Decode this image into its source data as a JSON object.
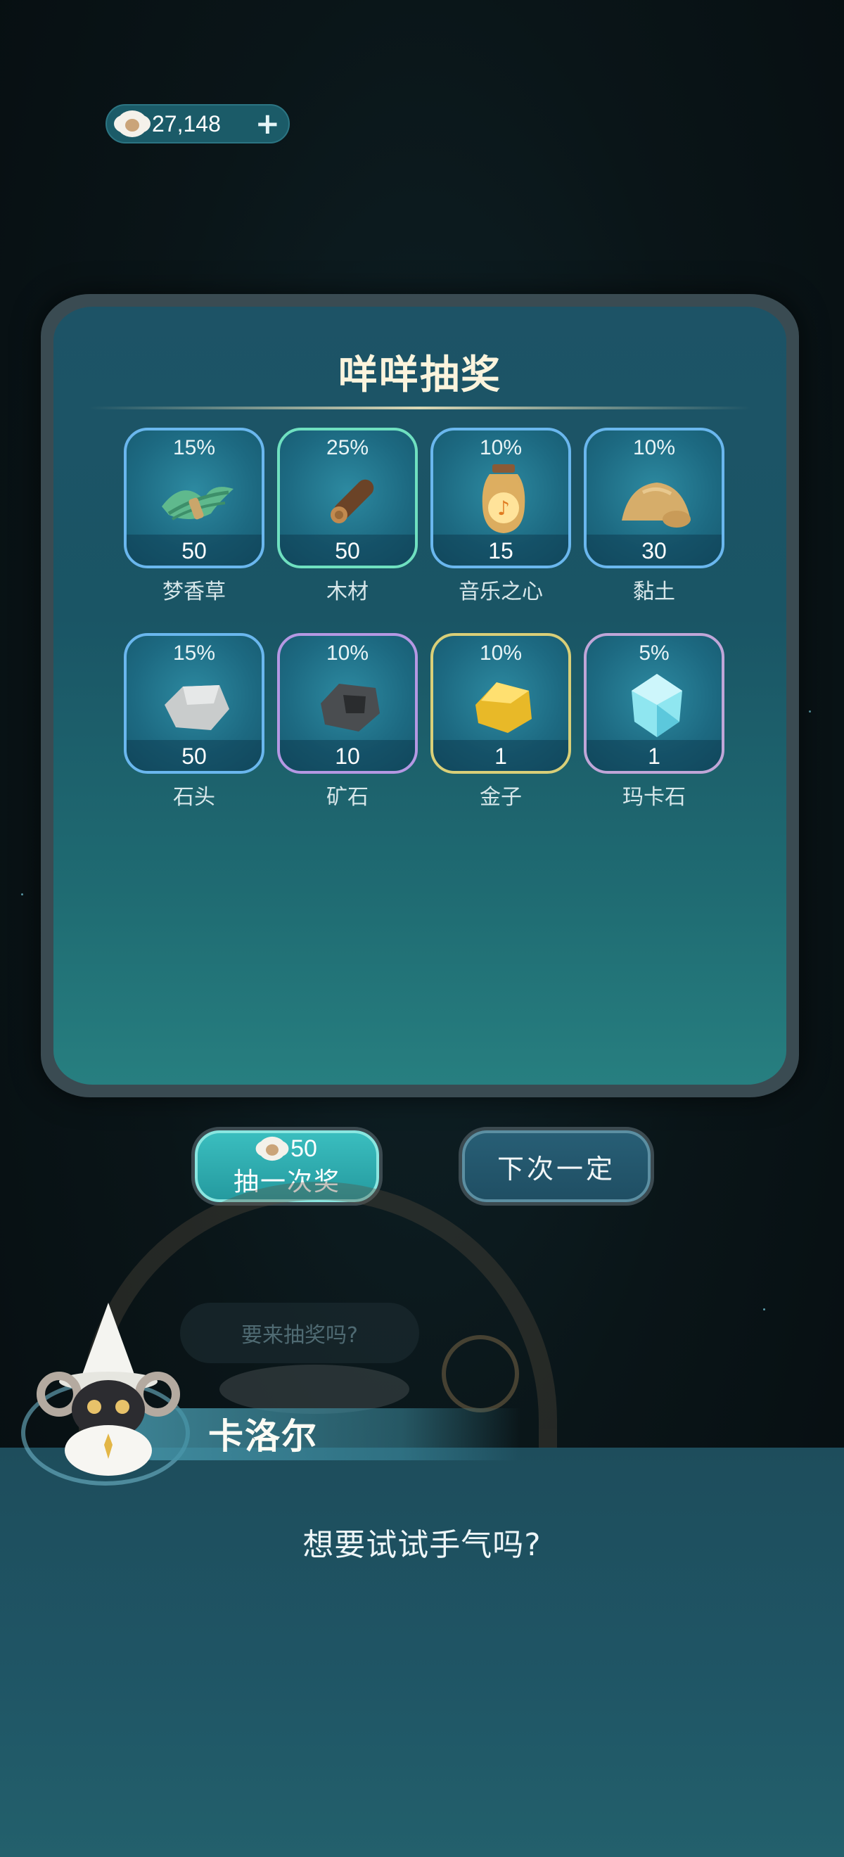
{
  "currency": {
    "amount": "27,148",
    "plus_label": "+",
    "icon": "sheep-coin-icon"
  },
  "panel": {
    "title": "咩咩抽奖"
  },
  "prizes": [
    {
      "name": "梦香草",
      "chance": "15%",
      "quantity": "50",
      "icon": "grass-bundle-icon",
      "rarity": "blue"
    },
    {
      "name": "木材",
      "chance": "25%",
      "quantity": "50",
      "icon": "wood-log-icon",
      "rarity": "green"
    },
    {
      "name": "音乐之心",
      "chance": "10%",
      "quantity": "15",
      "icon": "music-heart-jar-icon",
      "rarity": "blue"
    },
    {
      "name": "黏土",
      "chance": "10%",
      "quantity": "30",
      "icon": "clay-pile-icon",
      "rarity": "blue"
    },
    {
      "name": "石头",
      "chance": "15%",
      "quantity": "50",
      "icon": "stone-icon",
      "rarity": "blue"
    },
    {
      "name": "矿石",
      "chance": "10%",
      "quantity": "10",
      "icon": "ore-icon",
      "rarity": "purple"
    },
    {
      "name": "金子",
      "chance": "10%",
      "quantity": "1",
      "icon": "gold-nugget-icon",
      "rarity": "gold"
    },
    {
      "name": "玛卡石",
      "chance": "5%",
      "quantity": "1",
      "icon": "maka-crystal-icon",
      "rarity": "rainbow"
    }
  ],
  "buttons": {
    "draw": {
      "cost": "50",
      "label": "抽一次奖"
    },
    "next_time": {
      "label": "下次一定"
    }
  },
  "background_bubble": "要来抽奖吗?",
  "dialog": {
    "speaker": "卡洛尔",
    "text": "想要试试手气吗?"
  },
  "colors": {
    "accent_teal": "#24999e",
    "panel_border": "#3a4b52",
    "title_cream": "#fbf4dd"
  }
}
